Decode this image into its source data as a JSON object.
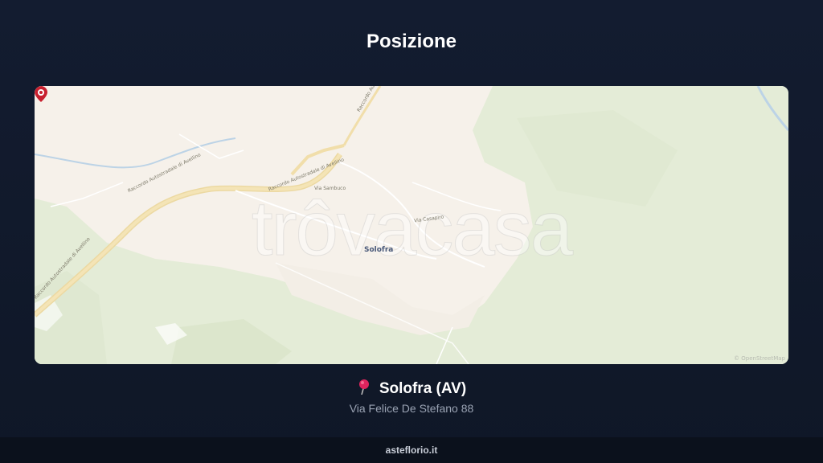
{
  "header": {
    "title": "Posizione"
  },
  "map": {
    "watermark": "trôvacasa",
    "place_label": "Solofra",
    "road_labels": {
      "r1": "Raccordo Autostradale di Avellino",
      "r2": "Raccordo Autostradale di Avellino",
      "r3": "Raccordo Autostradale di Avellino",
      "r4": "Raccordo Autostradale di Avellino",
      "r5": "Via Sambuco",
      "r6": "Via Casapiro"
    },
    "attribution": "© OpenStreetMap",
    "marker_icon": "location-marker-icon"
  },
  "location": {
    "icon": "pin-icon",
    "name": "Solofra (AV)",
    "address": "Via Felice De Stefano 88"
  },
  "footer": {
    "site": "asteflorio.it"
  },
  "colors": {
    "background": "#131c30",
    "map_land": "#e9efdf",
    "map_town": "#f7f1ec",
    "highway": "#f1deaa",
    "marker": "#c8202f",
    "subtitle": "#9aa3b3"
  }
}
